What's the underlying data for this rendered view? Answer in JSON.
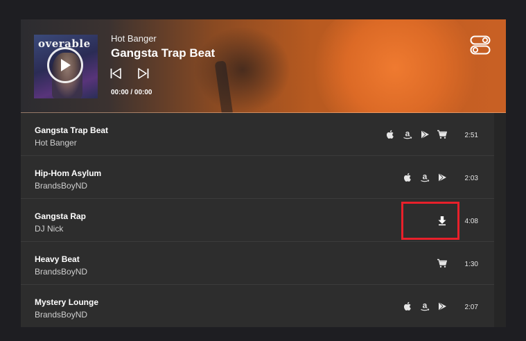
{
  "player": {
    "artist": "Hot Banger",
    "title": "Gangsta Trap Beat",
    "time": "00:00 / 00:00",
    "album_art_text": "overable"
  },
  "tracks": [
    {
      "title": "Gangsta Trap Beat",
      "artist": "Hot Banger",
      "duration": "2:51",
      "icons": [
        "apple-icon",
        "amazon-icon",
        "google-play-icon",
        "cart-icon"
      ]
    },
    {
      "title": "Hip-Hom Asylum",
      "artist": "BrandsBoyND",
      "duration": "2:03",
      "icons": [
        "apple-icon",
        "amazon-icon",
        "google-play-icon"
      ]
    },
    {
      "title": "Gangsta Rap",
      "artist": "DJ Nick",
      "duration": "4:08",
      "icons": [
        "download-icon"
      ]
    },
    {
      "title": "Heavy Beat",
      "artist": "BrandsBoyND",
      "duration": "1:30",
      "icons": [
        "cart-icon"
      ]
    },
    {
      "title": "Mystery Lounge",
      "artist": "BrandsBoyND",
      "duration": "2:07",
      "icons": [
        "apple-icon",
        "amazon-icon",
        "google-play-icon"
      ]
    }
  ],
  "colors": {
    "page_bg": "#1e1e22",
    "row_bg": "#2d2d2d",
    "highlight": "#e8202a",
    "accent_orange": "#dc6a26"
  }
}
